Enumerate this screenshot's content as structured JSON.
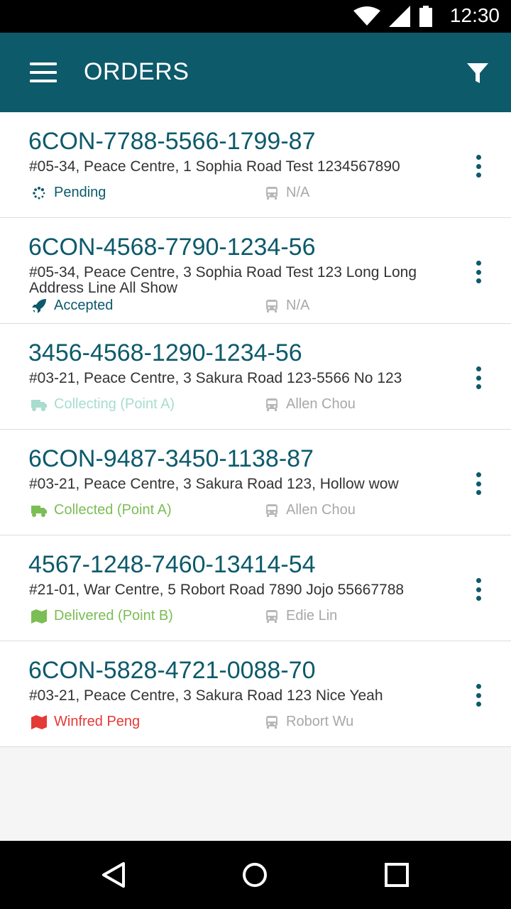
{
  "status_bar": {
    "time": "12:30",
    "icons": [
      "wifi-icon",
      "signal-icon",
      "battery-icon"
    ]
  },
  "app_bar": {
    "title": "ORDERS",
    "menu_icon": "hamburger-menu-icon",
    "filter_icon": "filter-icon"
  },
  "orders": [
    {
      "code": "6CON-7788-5566-1799-87",
      "address": "#05-34, Peace Centre, 1 Sophia Road Test 1234567890",
      "status": "Pending",
      "status_icon": "spinner-icon",
      "status_color": "#0d5a6b",
      "driver": "N/A"
    },
    {
      "code": "6CON-4568-7790-1234-56",
      "address": "#05-34, Peace Centre, 3 Sophia Road Test 123  Long Long Address Line All Show",
      "status": "Accepted",
      "status_icon": "rocket-icon",
      "status_color": "#0d5a6b",
      "driver": "N/A"
    },
    {
      "code": "3456-4568-1290-1234-56",
      "address": "#03-21, Peace Centre, 3 Sakura Road 123-5566 No 123",
      "status": "Collecting (Point A)",
      "status_icon": "truck-icon",
      "status_color": "#a8dccf",
      "driver": "Allen Chou"
    },
    {
      "code": "6CON-9487-3450-1138-87",
      "address": "#03-21, Peace Centre, 3 Sakura Road 123, Hollow wow",
      "status": "Collected (Point A)",
      "status_icon": "truck-icon",
      "status_color": "#7cbd55",
      "driver": "Allen Chou"
    },
    {
      "code": "4567-1248-7460-13414-54",
      "address": "#21-01, War Centre, 5 Robort Road 7890 Jojo 55667788",
      "status": "Delivered (Point B)",
      "status_icon": "map-icon",
      "status_color": "#7cbd55",
      "driver": "Edie Lin"
    },
    {
      "code": "6CON-5828-4721-0088-70",
      "address": "#03-21, Peace Centre, 3 Sakura Road 123 Nice Yeah",
      "status": "Winfred Peng",
      "status_icon": "map-icon",
      "status_color": "#e53935",
      "driver": "Robort Wu"
    }
  ],
  "driver_icon": "bus-icon",
  "nav_bar": {
    "buttons": [
      "back-icon",
      "home-icon",
      "recents-icon"
    ]
  }
}
